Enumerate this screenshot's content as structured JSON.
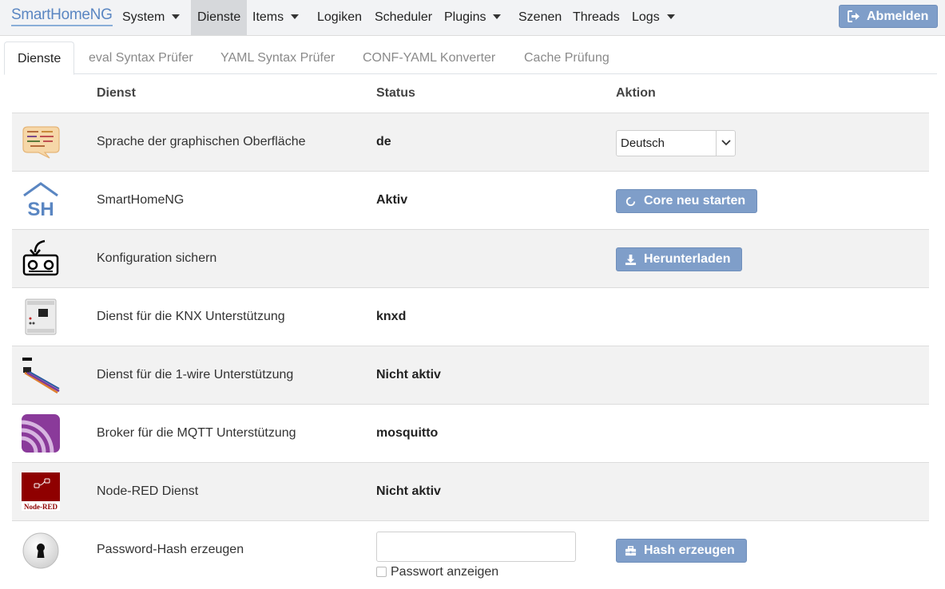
{
  "navbar": {
    "brand": "SmartHomeNG",
    "items": [
      {
        "label": "System",
        "dropdown": true
      },
      {
        "label": "Dienste",
        "dropdown": false,
        "active": true
      },
      {
        "label": "Items",
        "dropdown": true
      },
      {
        "label": "Logiken",
        "dropdown": false
      },
      {
        "label": "Scheduler",
        "dropdown": false
      },
      {
        "label": "Plugins",
        "dropdown": true
      },
      {
        "label": "Szenen",
        "dropdown": false
      },
      {
        "label": "Threads",
        "dropdown": false
      },
      {
        "label": "Logs",
        "dropdown": true
      }
    ],
    "logout_label": "Abmelden"
  },
  "tabs": [
    {
      "label": "Dienste",
      "active": true
    },
    {
      "label": "eval Syntax Prüfer"
    },
    {
      "label": "YAML Syntax Prüfer"
    },
    {
      "label": "CONF-YAML Konverter"
    },
    {
      "label": "Cache Prüfung"
    }
  ],
  "table": {
    "headers": {
      "dienst": "Dienst",
      "status": "Status",
      "aktion": "Aktion"
    },
    "rows": [
      {
        "icon": "language-speech-bubble-icon",
        "name": "Sprache der graphischen Oberfläche",
        "status": "de",
        "action_type": "select",
        "action_value": "Deutsch"
      },
      {
        "icon": "smarthomeng-logo-icon",
        "name": "SmartHomeNG",
        "status": "Aktiv",
        "action_type": "button",
        "action_label": "Core neu starten",
        "action_icon": "refresh-icon"
      },
      {
        "icon": "backup-tape-icon",
        "name": "Konfiguration sichern",
        "status": "",
        "action_type": "button",
        "action_label": "Herunterladen",
        "action_icon": "download-icon"
      },
      {
        "icon": "knx-device-icon",
        "name": "Dienst für die KNX Unterstützung",
        "status": "knxd",
        "action_type": "none"
      },
      {
        "icon": "onewire-cable-icon",
        "name": "Dienst für die 1-wire Unterstützung",
        "status": "Nicht aktiv",
        "action_type": "none"
      },
      {
        "icon": "mqtt-signal-icon",
        "name": "Broker für die MQTT Unterstützung",
        "status": "mosquitto",
        "action_type": "none"
      },
      {
        "icon": "node-red-logo-icon",
        "name": "Node-RED Dienst",
        "status": "Nicht aktiv",
        "action_type": "none",
        "icon_text": "Node-RED"
      },
      {
        "icon": "keyhole-icon",
        "name": "Password-Hash erzeugen",
        "status": "",
        "action_type": "button",
        "action_label": "Hash erzeugen",
        "action_icon": "toolbox-icon",
        "input_value": "",
        "checkbox_label": "Passwort anzeigen"
      }
    ]
  },
  "colors": {
    "primary_button": "#7f9ec9",
    "row_shade": "#f2f2f2",
    "brand": "#5a86c2",
    "active_nav": "#d6d8db",
    "node_red": "#8f0000"
  }
}
